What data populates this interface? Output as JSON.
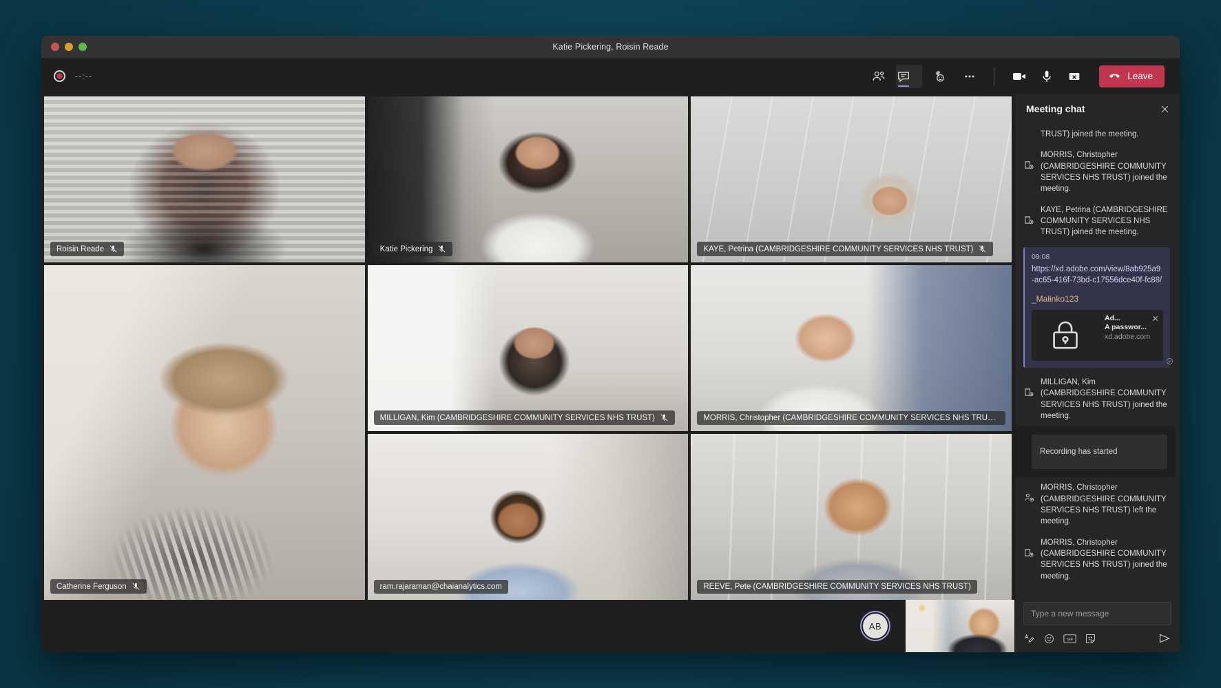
{
  "window": {
    "title": "Katie Pickering, Roisin Reade",
    "traffic_lights": [
      "close",
      "minimize",
      "maximize"
    ]
  },
  "toolbar": {
    "recording_indicator": "recording-dot",
    "timer": "--:--",
    "buttons": [
      {
        "name": "show-participants",
        "icon": "people-icon",
        "active": false
      },
      {
        "name": "show-conversation",
        "icon": "chat-icon",
        "active": true
      },
      {
        "name": "show-reactions",
        "icon": "reactions-icon",
        "active": false
      },
      {
        "name": "more-actions",
        "icon": "ellipsis-icon",
        "active": false
      }
    ],
    "controls": [
      {
        "name": "toggle-camera",
        "icon": "camera-icon"
      },
      {
        "name": "toggle-mic",
        "icon": "microphone-icon"
      },
      {
        "name": "share-screen",
        "icon": "share-screen-icon"
      }
    ],
    "leave_label": "Leave",
    "leave_icon": "hangup-icon",
    "leave_color": "#c3364f"
  },
  "tiles": [
    {
      "name": "roisin-reade",
      "label": "Roisin Reade",
      "muted": true
    },
    {
      "name": "katie-pickering",
      "label": "Katie Pickering",
      "muted": true
    },
    {
      "name": "kaye-petrina",
      "label": "KAYE, Petrina (CAMBRIDGESHIRE COMMUNITY SERVICES NHS TRUST)",
      "muted": true
    },
    {
      "name": "milligan-kim",
      "label": "MILLIGAN, Kim (CAMBRIDGESHIRE COMMUNITY SERVICES NHS TRUST)",
      "muted": true
    },
    {
      "name": "morris-christopher",
      "label": "MORRIS, Christopher (CAMBRIDGESHIRE COMMUNITY SERVICES NHS TRUST)",
      "muted": false
    },
    {
      "name": "catherine-ferguson",
      "label": "Catherine Ferguson",
      "muted": true
    },
    {
      "name": "ram-rajaraman",
      "label": "ram.rajaraman@chaianalytics.com",
      "muted": false
    },
    {
      "name": "reeve-pete",
      "label": "REEVE, Pete (CAMBRIDGESHIRE COMMUNITY SERVICES NHS TRUST)",
      "muted": false
    }
  ],
  "footer": {
    "avatar_initials": "AB",
    "avatar_ring_color": "#9a9ae8",
    "selfview_label": "self-view"
  },
  "chat": {
    "title": "Meeting chat",
    "close_icon": "close-icon",
    "messages": [
      {
        "type": "system",
        "icon": "join-meeting-icon",
        "text": "TRUST) joined the meeting.",
        "truncated_top": true
      },
      {
        "type": "system",
        "icon": "join-meeting-icon",
        "text": "MORRIS, Christopher (CAMBRIDGESHIRE COMMUNITY SERVICES NHS TRUST) joined the meeting."
      },
      {
        "type": "system",
        "icon": "join-meeting-icon",
        "text": "KAYE, Petrina (CAMBRIDGESHIRE COMMUNITY SERVICES NHS TRUST) joined the meeting."
      }
    ],
    "link_message": {
      "time": "09:08",
      "url": "https://xd.adobe.com/view/8ab925a9-ac65-416f-73bd-c17556dce40f-fc88/",
      "password": "_Malinko123",
      "preview": {
        "icon": "lock-icon",
        "title": "Ad...",
        "description": "A passwor...",
        "domain": "xd.adobe.com",
        "close_icon": "close-icon"
      },
      "delivered_icon": "delivered-check-icon"
    },
    "messages_after": [
      {
        "type": "system",
        "icon": "join-meeting-icon",
        "text": "MILLIGAN, Kim (CAMBRIDGESHIRE COMMUNITY SERVICES NHS TRUST) joined the meeting."
      }
    ],
    "recording_notice": "Recording has started",
    "messages_tail": [
      {
        "type": "system",
        "icon": "leave-meeting-icon",
        "text": "MORRIS, Christopher (CAMBRIDGESHIRE COMMUNITY SERVICES NHS TRUST) left the meeting."
      },
      {
        "type": "system",
        "icon": "join-meeting-icon",
        "text": "MORRIS, Christopher (CAMBRIDGESHIRE COMMUNITY SERVICES NHS TRUST) joined the meeting."
      }
    ],
    "compose": {
      "placeholder": "Type a new message",
      "tools": [
        {
          "name": "format-icon"
        },
        {
          "name": "emoji-icon"
        },
        {
          "name": "gif-icon"
        },
        {
          "name": "sticker-icon"
        }
      ],
      "send_icon": "send-icon"
    }
  }
}
